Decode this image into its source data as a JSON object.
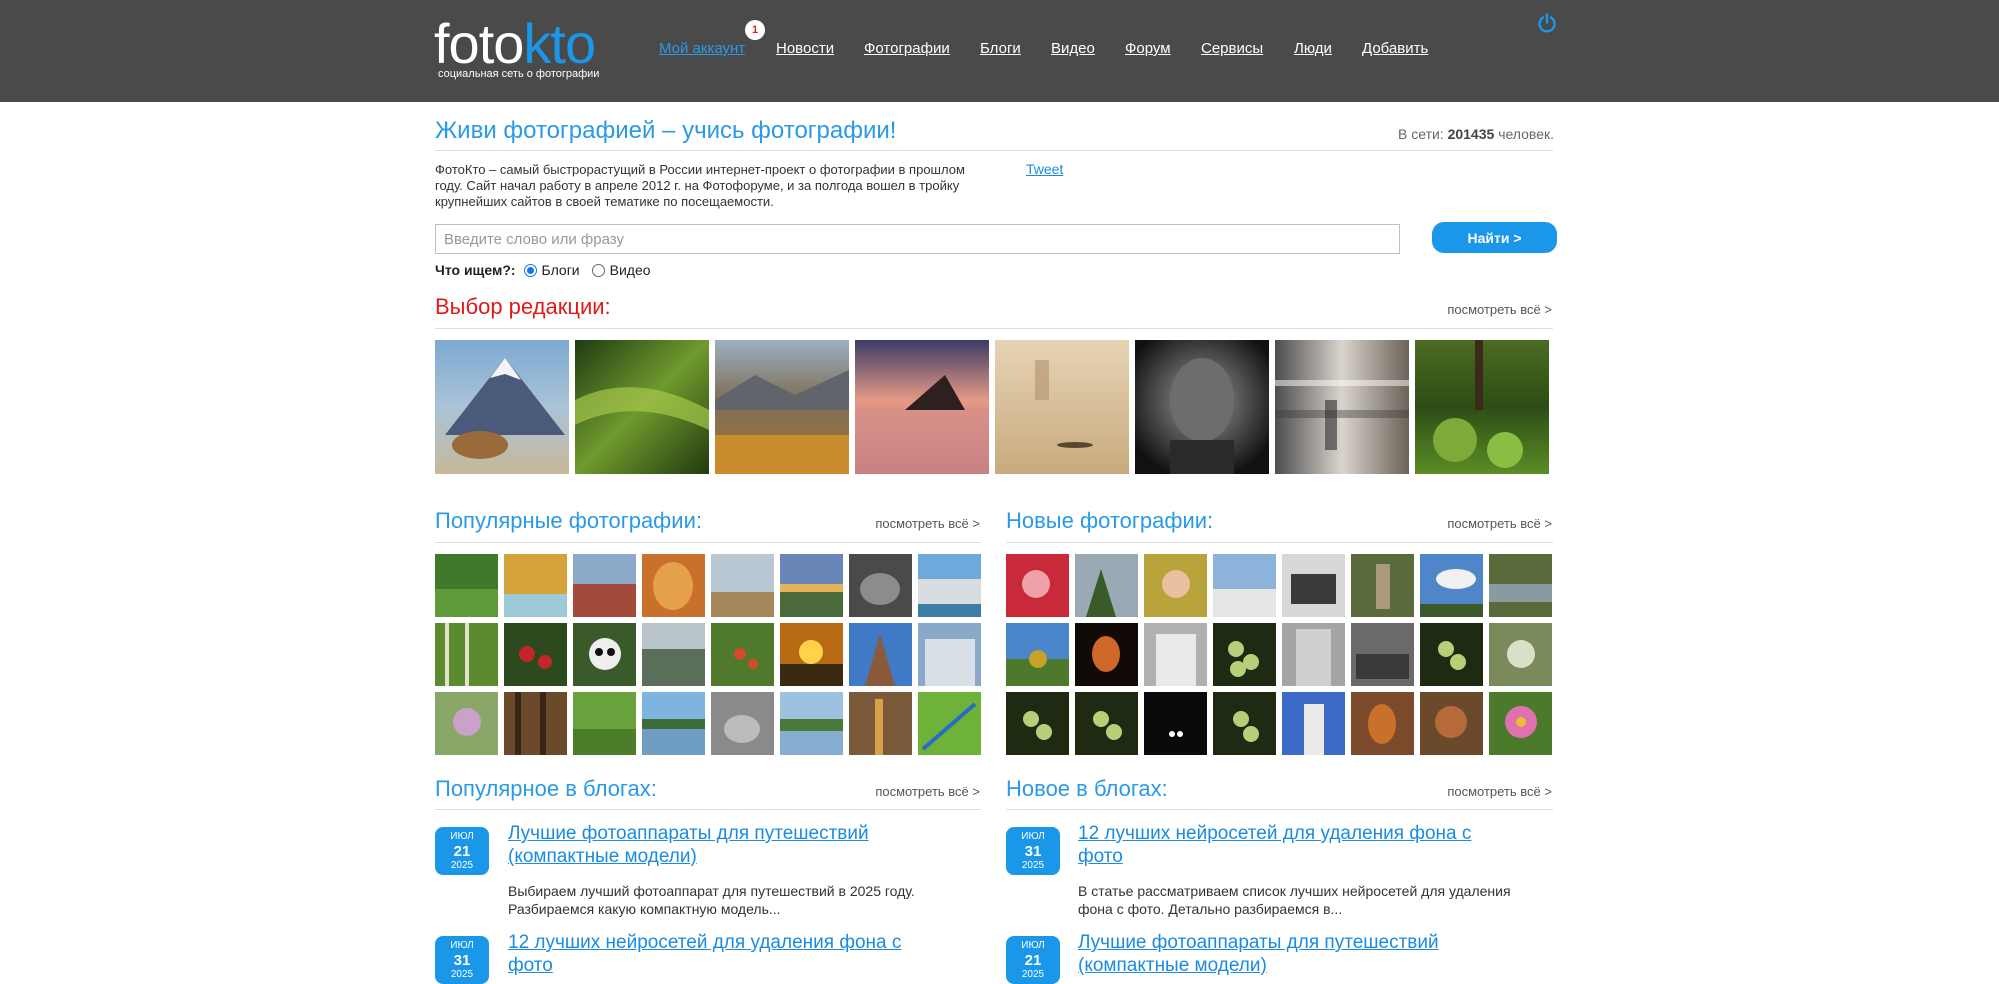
{
  "header": {
    "logo_foto": "foto",
    "logo_kto": "kto",
    "logo_sub": "социальная сеть о фотографии",
    "nav": [
      {
        "label": "Мой аккаунт"
      },
      {
        "label": "Новости"
      },
      {
        "label": "Фотографии"
      },
      {
        "label": "Блоги"
      },
      {
        "label": "Видео"
      },
      {
        "label": "Форум"
      },
      {
        "label": "Сервисы"
      },
      {
        "label": "Люди"
      },
      {
        "label": "Добавить"
      }
    ],
    "notification_count": "1",
    "power_icon": "power-icon"
  },
  "main": {
    "title": "Живи фотографией – учись фотографии!",
    "online_prefix": "В сети:",
    "online_count": "201435",
    "online_suffix": "человек.",
    "intro": "ФотоКто – самый быстрорастущий в России интернет-проект о фотографии в прошлом году. Сайт начал работу в апреле 2012 г. на Фотофоруме, и за полгода вошел в тройку крупнейших сайтов в своей тематике по посещаемости.",
    "tweet": "Tweet"
  },
  "search": {
    "placeholder": "Введите слово или фразу",
    "value": "",
    "button": "Найти >",
    "what_label": "Что ищем?:",
    "options": [
      {
        "label": "Блоги",
        "checked": true
      },
      {
        "label": "Видео",
        "checked": false
      }
    ]
  },
  "editors_choice": {
    "title": "Выбор редакции:",
    "see_all": "посмотреть всё >"
  },
  "popular_photos": {
    "title": "Популярные фотографии:",
    "see_all": "посмотреть всё >"
  },
  "new_photos": {
    "title": "Новые фотографии:",
    "see_all": "посмотреть всё >"
  },
  "popular_blogs": {
    "title": "Популярное в блогах:",
    "see_all": "посмотреть всё >",
    "items": [
      {
        "month": "ИЮЛ",
        "day": "21",
        "year": "2025",
        "title": "Лучшие фотоаппараты для путешествий (компактные модели)",
        "excerpt": "Выбираем лучший фотоаппарат для путешествий в 2025 году. Разбираемся какую компактную модель..."
      },
      {
        "month": "ИЮЛ",
        "day": "31",
        "year": "2025",
        "title": "12 лучших нейросетей для удаления фона с фото",
        "excerpt": ""
      }
    ]
  },
  "new_blogs": {
    "title": "Новое в блогах:",
    "see_all": "посмотреть всё >",
    "items": [
      {
        "month": "ИЮЛ",
        "day": "31",
        "year": "2025",
        "title": "12 лучших нейросетей для удаления фона с фото",
        "excerpt": "В статье рассматриваем список лучших нейросетей для удаления фона с фото. Детально разбираемся в..."
      },
      {
        "month": "ИЮЛ",
        "day": "21",
        "year": "2025",
        "title": "Лучшие фотоаппараты для путешествий (компактные модели)",
        "excerpt": ""
      }
    ]
  },
  "colors": {
    "header_bg": "#4a4a4a",
    "accent": "#1a97e9",
    "title_blue": "#2a9ae6",
    "editors_red": "#e01a1a",
    "link": "#1a8be0"
  }
}
